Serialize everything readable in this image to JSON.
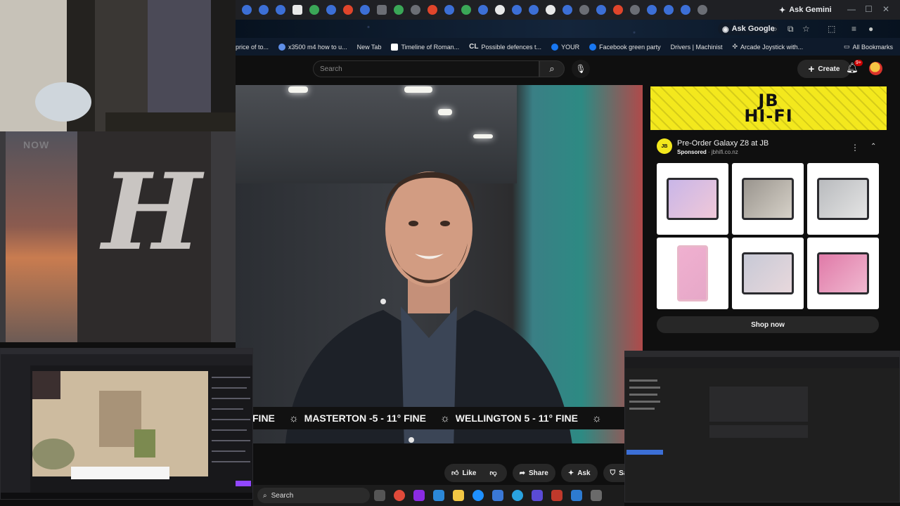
{
  "browser": {
    "ask_gemini_label": "Ask Gemini",
    "ask_google_label": "Ask Google"
  },
  "bookmarks": [
    {
      "label": "price of to..."
    },
    {
      "label": "x3500 m4 how to u..."
    },
    {
      "label": "New Tab"
    },
    {
      "label": "Timeline of Roman..."
    },
    {
      "label": "Possible defences t..."
    },
    {
      "label": "YOUR"
    },
    {
      "label": "Facebook green party"
    },
    {
      "label": "Drivers | Machinist"
    },
    {
      "label": "Arcade Joystick with..."
    }
  ],
  "all_bookmarks_label": "All Bookmarks",
  "youtube": {
    "search_placeholder": "Search",
    "create_label": "Create",
    "notification_badge": "9+"
  },
  "video": {
    "ticker": {
      "items": [
        "FINE",
        "MASTERTON -5 - 11° FINE",
        "WELLINGTON 5 - 11° FINE"
      ]
    }
  },
  "actions": {
    "like": "Like",
    "share": "Share",
    "ask": "Ask",
    "save": "Save"
  },
  "ad": {
    "banner_line1": "JB",
    "banner_line2": "HI-FI",
    "logo_text": "JB",
    "title": "Pre-Order Galaxy Z8 at JB",
    "sponsored": "Sponsored",
    "domain": "jbhifi.co.nz",
    "cta": "Shop now"
  },
  "overlay_news": {
    "now_text": "NOW",
    "logo_letter": "H"
  },
  "taskbar": {
    "search_label": "Search"
  },
  "colors": {
    "youtube_bg": "#0f0f0f",
    "jb_yellow": "#f3e81d",
    "ticker_bg": "#111111"
  }
}
